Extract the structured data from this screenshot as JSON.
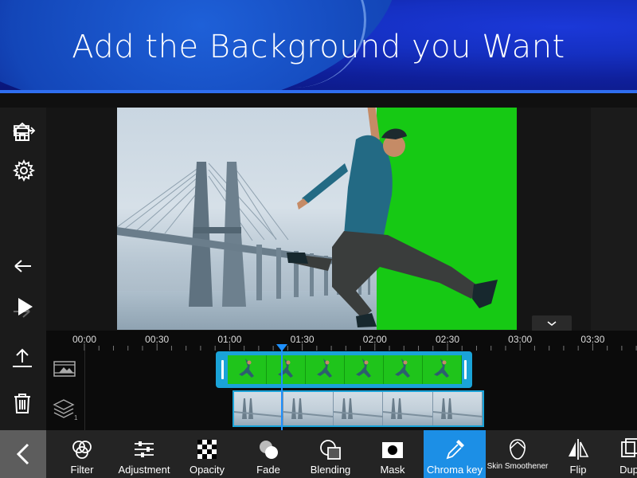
{
  "banner": {
    "title": "Add the Background you Want"
  },
  "left_toolbar": [
    {
      "name": "home",
      "icon": "home-icon"
    },
    {
      "name": "undo",
      "icon": "undo-icon"
    },
    {
      "name": "redo",
      "icon": "redo-icon"
    },
    {
      "name": "export",
      "icon": "export-icon"
    },
    {
      "name": "delete",
      "icon": "trash-icon"
    }
  ],
  "right_toolbar": [
    {
      "name": "produce",
      "icon": "produce-video-icon"
    },
    {
      "name": "settings",
      "icon": "gear-icon"
    },
    {
      "name": "play",
      "icon": "play-icon"
    }
  ],
  "timeline": {
    "ruler": [
      "00:00",
      "00:30",
      "01:00",
      "01:30",
      "02:00",
      "02:30",
      "03:00",
      "03:30"
    ],
    "tracks": [
      {
        "name": "video-track",
        "icon": "video-track-icon",
        "thumbnails": 6
      },
      {
        "name": "layer-track",
        "icon": "layers-icon",
        "badge": "1",
        "thumbnails": 5
      }
    ]
  },
  "bottom_tools": [
    {
      "label": "Filter",
      "icon": "filter-icon"
    },
    {
      "label": "Adjustment",
      "icon": "adjustment-icon"
    },
    {
      "label": "Opacity",
      "icon": "opacity-icon"
    },
    {
      "label": "Fade",
      "icon": "fade-icon"
    },
    {
      "label": "Blending",
      "icon": "blending-icon"
    },
    {
      "label": "Mask",
      "icon": "mask-icon"
    },
    {
      "label": "Chroma key",
      "icon": "chroma-key-icon",
      "active": true
    },
    {
      "label": "Skin Smoothener",
      "icon": "skin-smoothener-icon"
    },
    {
      "label": "Flip",
      "icon": "flip-icon"
    },
    {
      "label": "Dup",
      "icon": "duplicate-icon"
    }
  ],
  "colors": {
    "accent": "#1c8fe6",
    "chroma_green": "#16c914",
    "clip_border": "#1aa3d8",
    "banner_blue": "#1530c2"
  }
}
